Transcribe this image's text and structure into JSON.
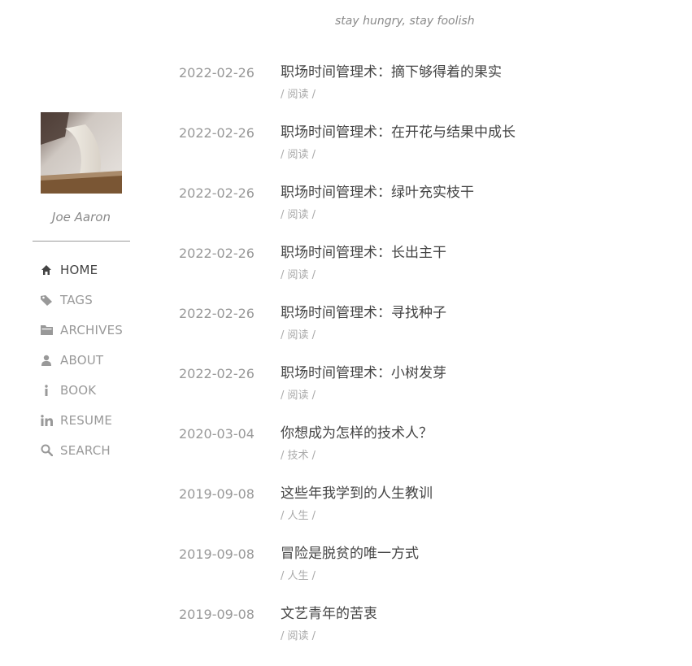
{
  "header": {
    "tagline": "stay hungry, stay foolish"
  },
  "sidebar": {
    "author": "Joe Aaron",
    "nav": [
      {
        "label": "HOME",
        "icon": "home-icon",
        "active": true
      },
      {
        "label": "TAGS",
        "icon": "tags-icon"
      },
      {
        "label": "ARCHIVES",
        "icon": "archive-icon"
      },
      {
        "label": "ABOUT",
        "icon": "user-icon"
      },
      {
        "label": "BOOK",
        "icon": "info-icon"
      },
      {
        "label": "RESUME",
        "icon": "linkedin-icon"
      },
      {
        "label": "SEARCH",
        "icon": "search-icon"
      }
    ]
  },
  "posts": [
    {
      "date": "2022-02-26",
      "title": "职场时间管理术：摘下够得着的果实",
      "category": "/ 阅读 /"
    },
    {
      "date": "2022-02-26",
      "title": "职场时间管理术：在开花与结果中成长",
      "category": "/ 阅读 /"
    },
    {
      "date": "2022-02-26",
      "title": "职场时间管理术：绿叶充实枝干",
      "category": "/ 阅读 /"
    },
    {
      "date": "2022-02-26",
      "title": "职场时间管理术：长出主干",
      "category": "/ 阅读 /"
    },
    {
      "date": "2022-02-26",
      "title": "职场时间管理术：寻找种子",
      "category": "/ 阅读 /"
    },
    {
      "date": "2022-02-26",
      "title": "职场时间管理术：小树发芽",
      "category": "/ 阅读 /"
    },
    {
      "date": "2020-03-04",
      "title": "你想成为怎样的技术人？",
      "category": "/ 技术 /"
    },
    {
      "date": "2019-09-08",
      "title": "这些年我学到的人生教训",
      "category": "/ 人生 /"
    },
    {
      "date": "2019-09-08",
      "title": "冒险是脱贫的唯一方式",
      "category": "/ 人生 /"
    },
    {
      "date": "2019-09-08",
      "title": "文艺青年的苦衷",
      "category": "/ 阅读 /"
    }
  ]
}
